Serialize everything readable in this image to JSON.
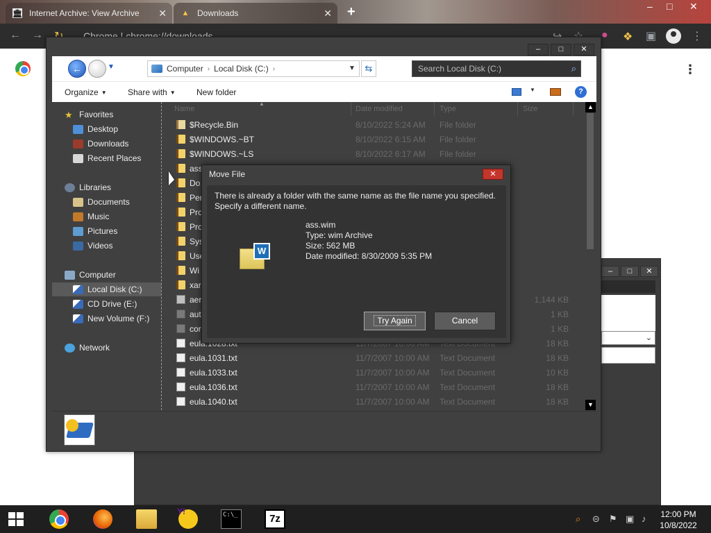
{
  "browser": {
    "tabs": [
      {
        "title": "Internet Archive: View Archive",
        "icon": "internet-archive-icon"
      },
      {
        "title": "Downloads",
        "icon": "downloads-icon"
      }
    ],
    "new_tab": "+",
    "omnibox_text": "Chrome  |  chrome://downloads",
    "window_controls": [
      "–",
      "□",
      "✕"
    ]
  },
  "explorer": {
    "window_controls": [
      "–",
      "□",
      "✕"
    ],
    "address": {
      "segments": [
        "Computer",
        "Local Disk (C:)"
      ]
    },
    "search_placeholder": "Search Local Disk (C:)",
    "commands": {
      "organize": "Organize",
      "share_with": "Share with",
      "new_folder": "New folder"
    },
    "nav": {
      "favorites": "Favorites",
      "favorites_items": [
        "Desktop",
        "Downloads",
        "Recent Places"
      ],
      "libraries": "Libraries",
      "libraries_items": [
        "Documents",
        "Music",
        "Pictures",
        "Videos"
      ],
      "computer": "Computer",
      "computer_items": [
        "Local Disk (C:)",
        "CD Drive (E:)",
        "New Volume (F:)"
      ],
      "network": "Network",
      "selected": "Local Disk (C:)"
    },
    "columns": [
      "Name",
      "Date modified",
      "Type",
      "Size"
    ],
    "files": [
      {
        "name": "$Recycle.Bin",
        "date": "8/10/2022 5:24 AM",
        "type": "File folder",
        "size": "",
        "icon": "sysfolder"
      },
      {
        "name": "$WINDOWS.~BT",
        "date": "8/10/2022 6:15 AM",
        "type": "File folder",
        "size": "",
        "icon": "folder"
      },
      {
        "name": "$WINDOWS.~LS",
        "date": "8/10/2022 6:17 AM",
        "type": "File folder",
        "size": "",
        "icon": "folder"
      },
      {
        "name": "ass",
        "date": "",
        "type": "",
        "size": "",
        "icon": "folder"
      },
      {
        "name": "Do",
        "date": "",
        "type": "",
        "size": "",
        "icon": "folder"
      },
      {
        "name": "Per",
        "date": "",
        "type": "",
        "size": "",
        "icon": "folder"
      },
      {
        "name": "Pro",
        "date": "",
        "type": "",
        "size": "",
        "icon": "folder"
      },
      {
        "name": "Pro",
        "date": "",
        "type": "",
        "size": "",
        "icon": "folder"
      },
      {
        "name": "Sys",
        "date": "",
        "type": "",
        "size": "",
        "icon": "folder"
      },
      {
        "name": "Use",
        "date": "",
        "type": "",
        "size": "",
        "icon": "folder"
      },
      {
        "name": "Wi",
        "date": "",
        "type": "",
        "size": "",
        "icon": "folder"
      },
      {
        "name": "xar",
        "date": "",
        "type": "",
        "size": "",
        "icon": "folder"
      },
      {
        "name": "aer",
        "date": "",
        "type": "",
        "size": "1,144 KB",
        "icon": "app"
      },
      {
        "name": "aut",
        "date": "",
        "type": "",
        "size": "1 KB",
        "icon": "cfg"
      },
      {
        "name": "cor",
        "date": "",
        "type": "",
        "size": "1 KB",
        "icon": "cfg"
      },
      {
        "name": "eula.1028.txt",
        "date": "11/7/2007 10:00 AM",
        "type": "Text Document",
        "size": "18 KB",
        "icon": "txt"
      },
      {
        "name": "eula.1031.txt",
        "date": "11/7/2007 10:00 AM",
        "type": "Text Document",
        "size": "18 KB",
        "icon": "txt"
      },
      {
        "name": "eula.1033.txt",
        "date": "11/7/2007 10:00 AM",
        "type": "Text Document",
        "size": "10 KB",
        "icon": "txt"
      },
      {
        "name": "eula.1036.txt",
        "date": "11/7/2007 10:00 AM",
        "type": "Text Document",
        "size": "18 KB",
        "icon": "txt"
      },
      {
        "name": "eula.1040.txt",
        "date": "11/7/2007 10:00 AM",
        "type": "Text Document",
        "size": "18 KB",
        "icon": "txt"
      }
    ]
  },
  "dialog": {
    "title": "Move File",
    "close": "✕",
    "message_line1": "There is already a folder with the same name as the file name you specified.",
    "message_line2": "Specify a different name.",
    "file_name": "ass.wim",
    "file_type": "Type: wim Archive",
    "file_size": "Size: 562 MB",
    "file_modified": "Date modified: 8/30/2009 5:35 PM",
    "try_again": "Try Again",
    "cancel": "Cancel",
    "file_icon_badge": "W"
  },
  "taskbar": {
    "time": "12:00 PM",
    "date": "10/8/2022",
    "cmd_label": "C:\\_",
    "sevenzip_label": "7z",
    "yahoo_label": "Y!"
  },
  "colors": {
    "explorer_bg": "#404040",
    "dialog_close": "#c4352c",
    "taskbar": "#1f1f1f"
  }
}
